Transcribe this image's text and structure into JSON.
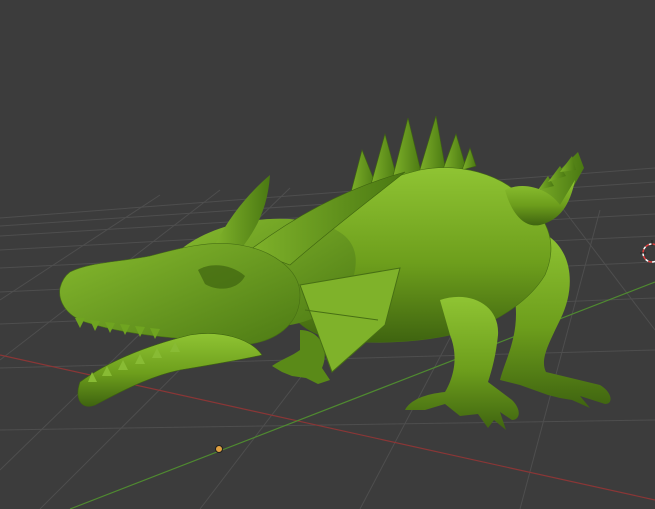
{
  "viewport": {
    "type": "3d-viewport",
    "background_color": "#3c3c3c",
    "grid_color": "#555555",
    "axis_x_color": "#9a3a3a",
    "axis_y_color": "#5a9a3a",
    "object": {
      "name_icon": "dragon-mesh",
      "color": "#6d9e1c",
      "shadow_color": "#3f6410",
      "highlight_color": "#8fc433"
    },
    "origin_marker_color": "#e0a040",
    "cursor_icon": "3d-cursor-icon"
  }
}
